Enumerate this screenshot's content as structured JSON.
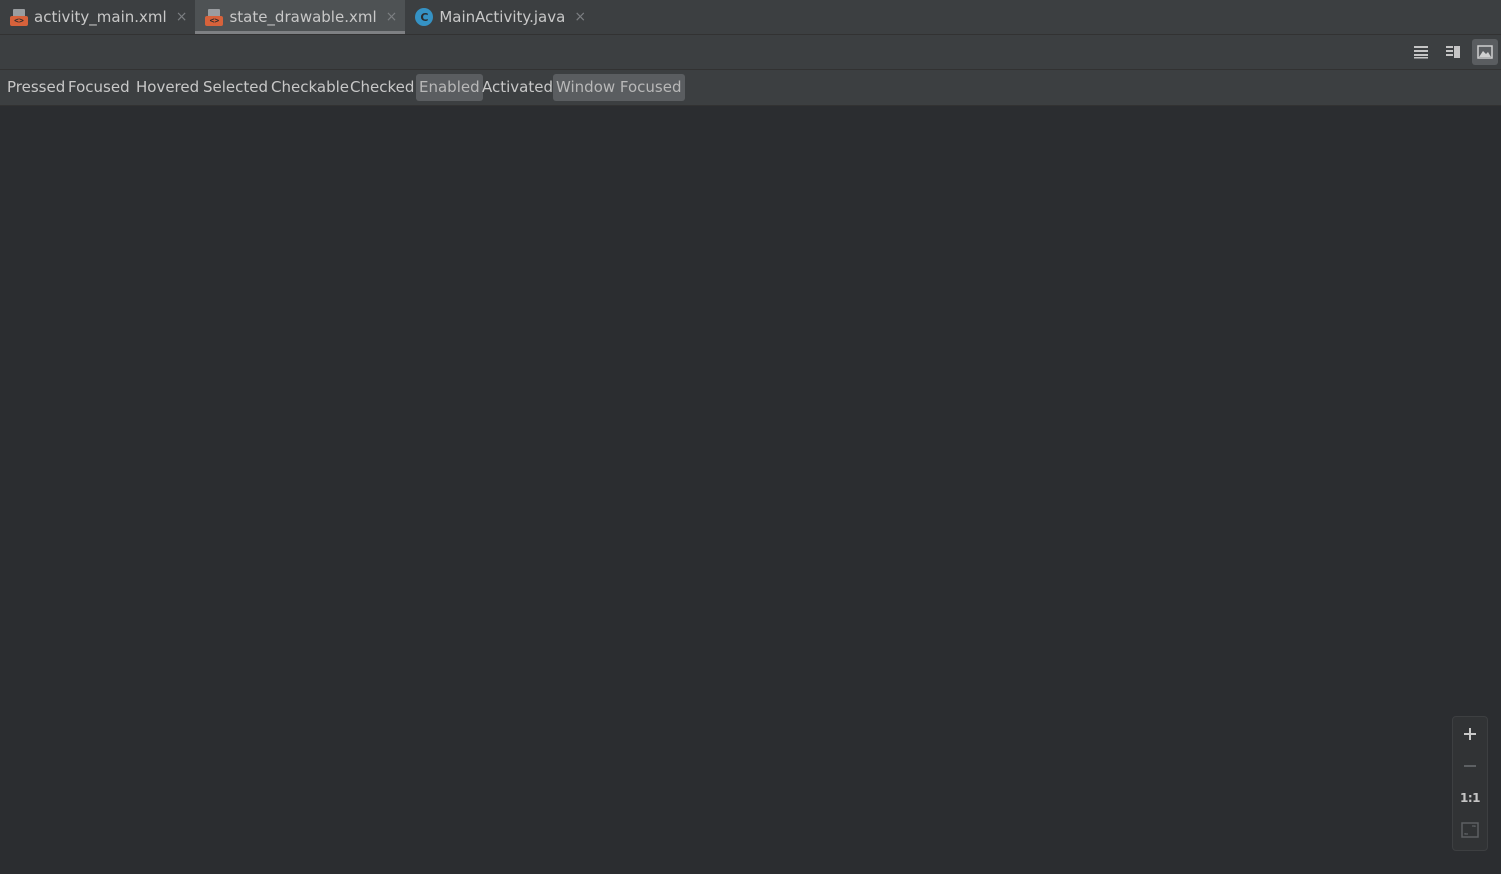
{
  "tabs": [
    {
      "label": "activity_main.xml",
      "icon": "xml-file-icon",
      "active": false
    },
    {
      "label": "state_drawable.xml",
      "icon": "xml-file-icon",
      "active": true
    },
    {
      "label": "MainActivity.java",
      "icon": "java-class-icon",
      "active": false
    }
  ],
  "tab_close_glyph": "×",
  "class_icon_letter": "C",
  "xml_badge_glyph": "<>",
  "view_modes": [
    {
      "name": "code-view-icon",
      "selected": false
    },
    {
      "name": "split-view-icon",
      "selected": false
    },
    {
      "name": "design-view-icon",
      "selected": true
    }
  ],
  "states": [
    {
      "label": "Pressed",
      "on": false
    },
    {
      "label": "Focused",
      "on": false
    },
    {
      "label": "Hovered",
      "on": false
    },
    {
      "label": "Selected",
      "on": false
    },
    {
      "label": "Checkable",
      "on": false
    },
    {
      "label": "Checked",
      "on": false
    },
    {
      "label": "Enabled",
      "on": true
    },
    {
      "label": "Activated",
      "on": false
    },
    {
      "label": "Window Focused",
      "on": true
    }
  ],
  "zoom": {
    "zoom_in": "+",
    "zoom_out": "−",
    "actual_size": "1:1",
    "fit_icon": "fit-screen-icon"
  },
  "colors": {
    "background": "#2b2d30",
    "panel": "#3c3f41",
    "xml_badge": "#d7623b",
    "class_icon": "#3592c4",
    "selected_chip": "#5a5d60"
  }
}
